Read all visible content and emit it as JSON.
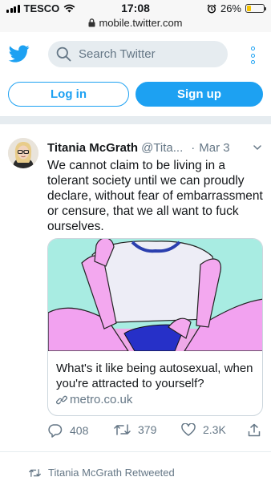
{
  "status_bar": {
    "carrier": "TESCO",
    "time": "17:08",
    "url": "mobile.twitter.com",
    "battery_percent": "26%",
    "battery_level": 0.26,
    "icons": [
      "signal-icon",
      "wifi-icon",
      "lock-icon",
      "alarm-icon",
      "battery-icon"
    ]
  },
  "header": {
    "logo": "twitter-bird-icon",
    "search_placeholder": "Search Twitter",
    "menu_icon": "more-vertical-icon"
  },
  "auth": {
    "login_label": "Log in",
    "signup_label": "Sign up"
  },
  "tweet": {
    "author_name": "Titania McGrath",
    "author_handle": "@Tita...",
    "separator": "·",
    "date": "Mar 3",
    "text": "We cannot claim to be living in a tolerant society until we can proudly declare, without fear of embarrassment or censure, that we all want to fuck ourselves.",
    "card": {
      "title": "What's it like being autosexual, when you're attracted to yourself?",
      "domain": "metro.co.uk"
    },
    "stats": {
      "replies": "408",
      "retweets": "379",
      "likes": "2.3K"
    }
  },
  "next_item": {
    "retweeted_label": "Titania McGrath Retweeted"
  },
  "colors": {
    "twitter_blue": "#1da1f2",
    "secondary_text": "#657786",
    "primary_text": "#14171a",
    "separator": "#e6ecf0"
  }
}
